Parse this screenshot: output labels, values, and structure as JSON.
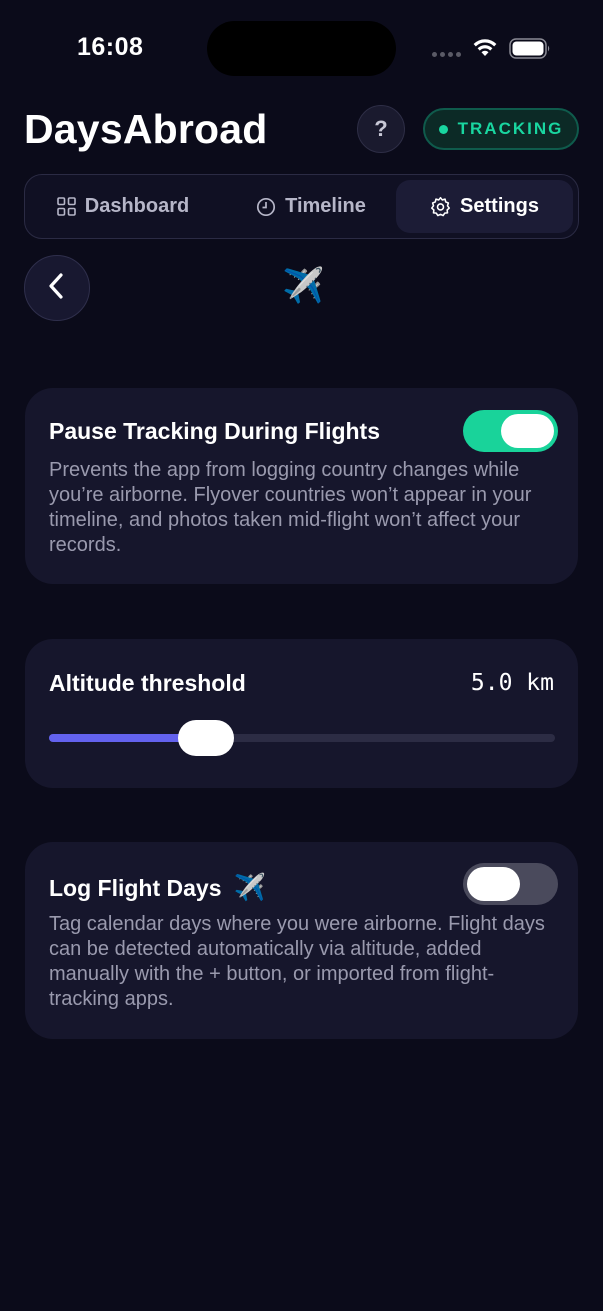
{
  "status_bar": {
    "time": "16:08"
  },
  "header": {
    "title": "DaysAbroad",
    "help_label": "?",
    "tracking_label": "TRACKING",
    "accent_color": "#19d6a0"
  },
  "tabs": [
    {
      "label": "Dashboard",
      "icon": "grid-icon",
      "active": false
    },
    {
      "label": "Timeline",
      "icon": "clock-icon",
      "active": false
    },
    {
      "label": "Settings",
      "icon": "gear-icon",
      "active": true
    }
  ],
  "page": {
    "icon": "✈️",
    "back_icon": "chevron-left-icon"
  },
  "pause_tracking": {
    "title": "Pause Tracking During Flights",
    "description": "Prevents the app from logging country changes while you’re airborne. Flyover countries won’t appear in your timeline, and photos taken mid-flight won’t affect your records.",
    "enabled": true
  },
  "altitude": {
    "title": "Altitude threshold",
    "value_text": "5.0 km",
    "slider_fraction": 0.31
  },
  "log_flight_days": {
    "title": "Log Flight Days",
    "title_icon": "✈️",
    "description": "Tag calendar days where you were airborne. Flight days can be detected automatically via altitude, added manually with the + button, or imported from flight-tracking apps.",
    "enabled": false
  }
}
